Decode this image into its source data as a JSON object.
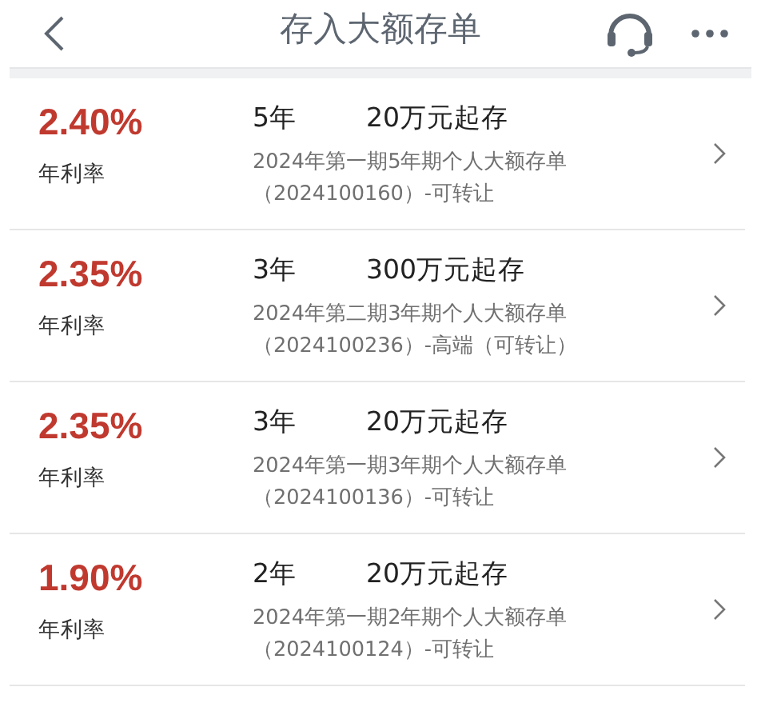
{
  "header": {
    "title": "存入大额存单"
  },
  "products": [
    {
      "rate": "2.40%",
      "rate_label": "年利率",
      "term": "5年",
      "minimum": "20万元起存",
      "name": "2024年第一期5年期个人大额存单",
      "note": "（2024100160）-可转让"
    },
    {
      "rate": "2.35%",
      "rate_label": "年利率",
      "term": "3年",
      "minimum": "300万元起存",
      "name": "2024年第二期3年期个人大额存单",
      "note": "（2024100236）-高端（可转让）"
    },
    {
      "rate": "2.35%",
      "rate_label": "年利率",
      "term": "3年",
      "minimum": "20万元起存",
      "name": "2024年第一期3年期个人大额存单",
      "note": "（2024100136）-可转让"
    },
    {
      "rate": "1.90%",
      "rate_label": "年利率",
      "term": "2年",
      "minimum": "20万元起存",
      "name": "2024年第一期2年期个人大额存单",
      "note": "（2024100124）-可转让"
    }
  ]
}
